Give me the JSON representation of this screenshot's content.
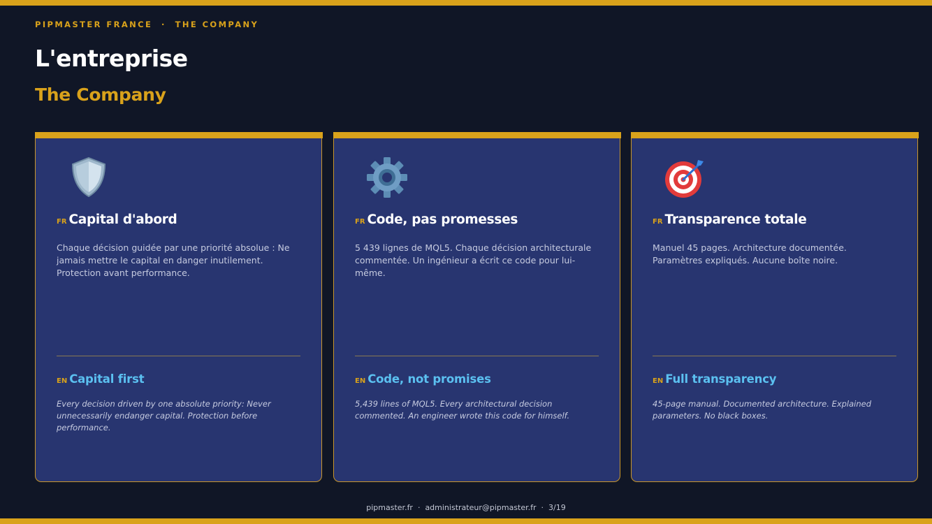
{
  "header": {
    "eyebrow": "PIPMASTER FRANCE  ·  THE COMPANY",
    "title": "L'entreprise",
    "subtitle": "The Company"
  },
  "cards": [
    {
      "icon": "shield-icon",
      "fr_tag": "FR",
      "fr_title": "Capital d'abord",
      "fr_text": "Chaque décision guidée par une priorité absolue : Ne jamais mettre le capital en danger inutilement. Protection avant performance.",
      "en_tag": "EN",
      "en_title": "Capital first",
      "en_text": "Every decision driven by one absolute priority: Never unnecessarily endanger capital. Protection before performance."
    },
    {
      "icon": "gear-icon",
      "fr_tag": "FR",
      "fr_title": "Code, pas promesses",
      "fr_text": "5 439 lignes de MQL5. Chaque décision architecturale commentée. Un ingénieur a écrit ce code pour lui-même.",
      "en_tag": "EN",
      "en_title": "Code, not promises",
      "en_text": "5,439 lines of MQL5. Every architectural decision commented. An engineer wrote this code for himself."
    },
    {
      "icon": "target-icon",
      "fr_tag": "FR",
      "fr_title": "Transparence totale",
      "fr_text": "Manuel 45 pages. Architecture documentée. Paramètres expliqués. Aucune boîte noire.",
      "en_tag": "EN",
      "en_title": "Full transparency",
      "en_text": "45-page manual. Documented architecture. Explained parameters. No black boxes."
    }
  ],
  "footer": {
    "text": "pipmaster.fr  ·  administrateur@pipmaster.fr  ·  3/19"
  },
  "colors": {
    "background": "#101626",
    "card": "#283570",
    "accent": "#d9a21b",
    "en_title": "#5bc0f0"
  }
}
